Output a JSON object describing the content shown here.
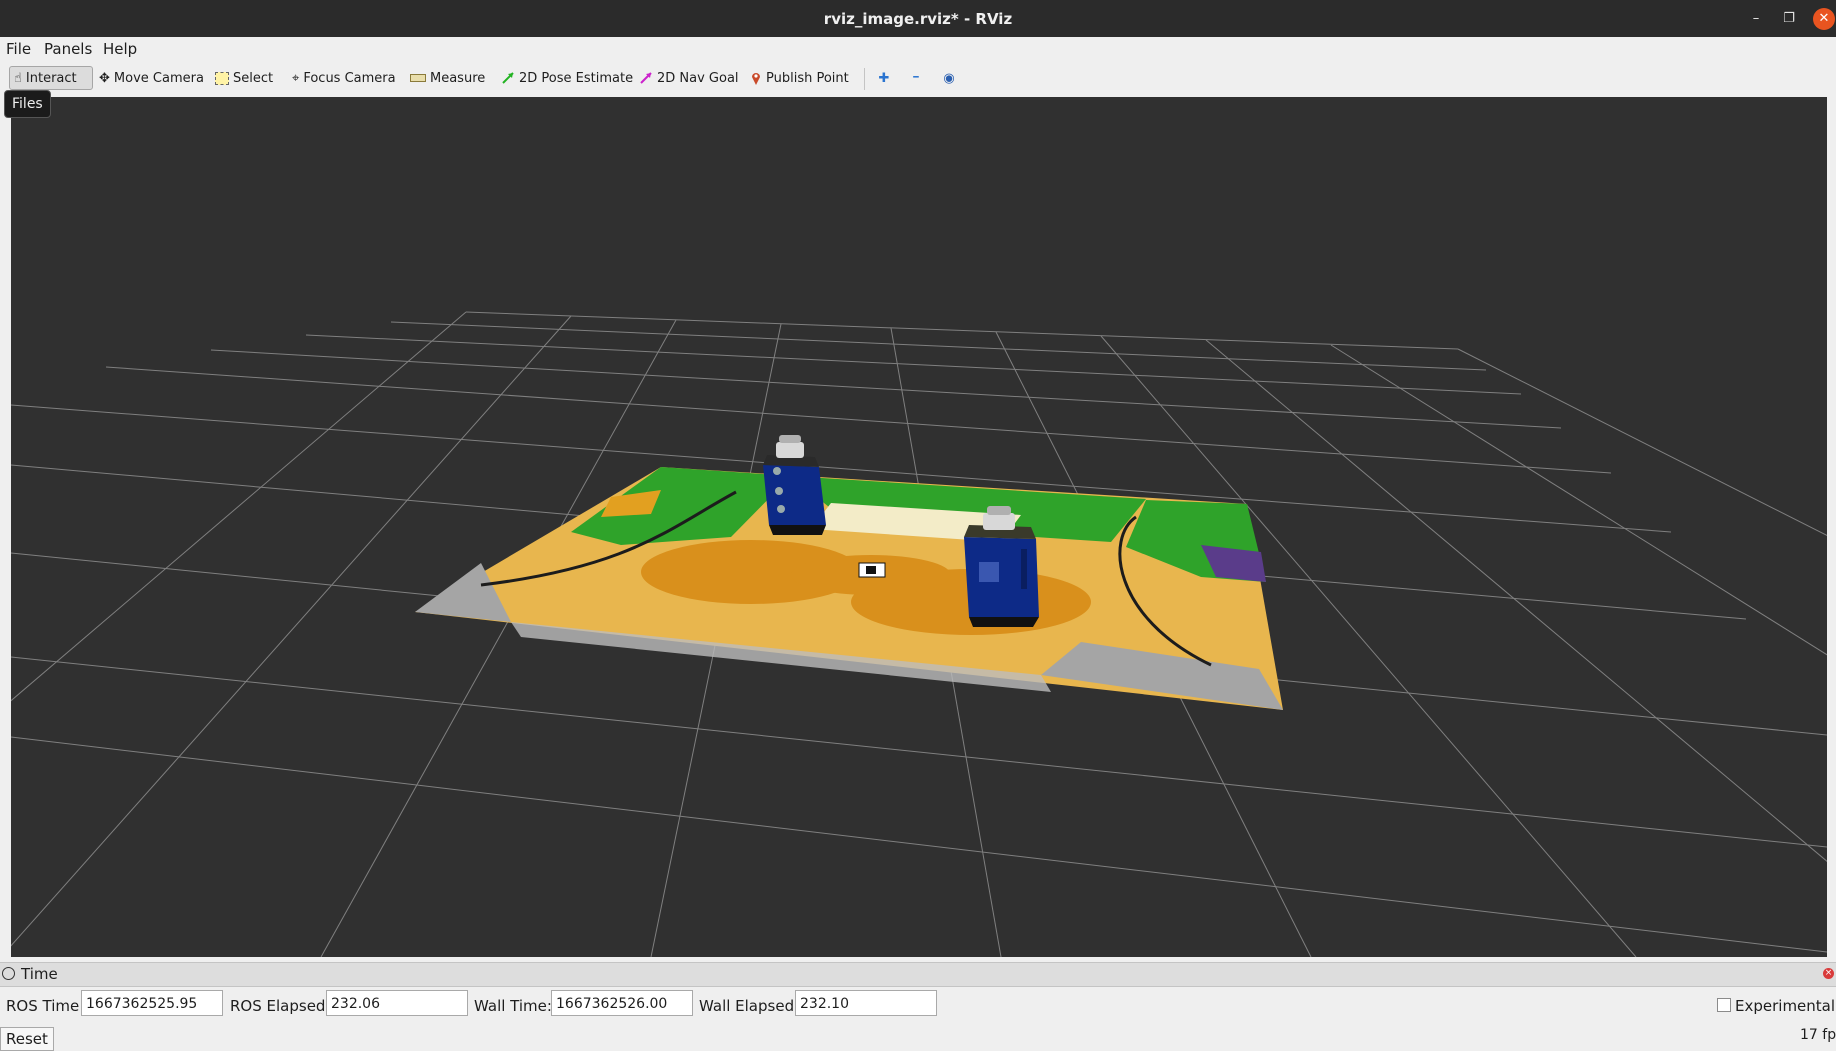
{
  "window": {
    "title": "rviz_image.rviz* - RViz",
    "minimize_glyph": "–",
    "maximize_glyph": "❐",
    "close_glyph": "✕"
  },
  "menu": {
    "file": "File",
    "panels": "Panels",
    "help": "Help"
  },
  "toolbar": {
    "interact": "Interact",
    "move_camera": "Move Camera",
    "select": "Select",
    "focus_camera": "Focus Camera",
    "measure": "Measure",
    "pose_estimate": "2D Pose Estimate",
    "nav_goal": "2D Nav Goal",
    "publish_point": "Publish Point"
  },
  "icons": {
    "hand": "☝",
    "move": "✥",
    "focus": "⌖",
    "pin": "●",
    "plus": "✚",
    "minus": "━",
    "eye": "◉"
  },
  "tooltip": "Files",
  "time_panel": {
    "title": "Time",
    "ros_time_label": "ROS Time:",
    "ros_time": "1667362525.95",
    "ros_elapsed_label": "ROS Elapsed:",
    "ros_elapsed": "232.06",
    "wall_time_label": "Wall Time:",
    "wall_time": "1667362526.00",
    "wall_elapsed_label": "Wall Elapsed:",
    "wall_elapsed": "232.10",
    "experimental_label": "Experimental",
    "close_glyph": "×"
  },
  "reset_label": "Reset",
  "fps": "17 fp",
  "colors": {
    "viewport_bg": "#303030",
    "grid": "#9a9a9a",
    "mat_sand": "#e8b64e",
    "mat_orange": "#d9901c",
    "mat_green": "#2fa32a",
    "robot_blue": "#0d2a87",
    "pose_green": "#22b322",
    "nav_magenta": "#cc22cc",
    "pin_red": "#c94a2a",
    "plus_blue": "#2a74d0",
    "minus_blue": "#2a74d0"
  }
}
